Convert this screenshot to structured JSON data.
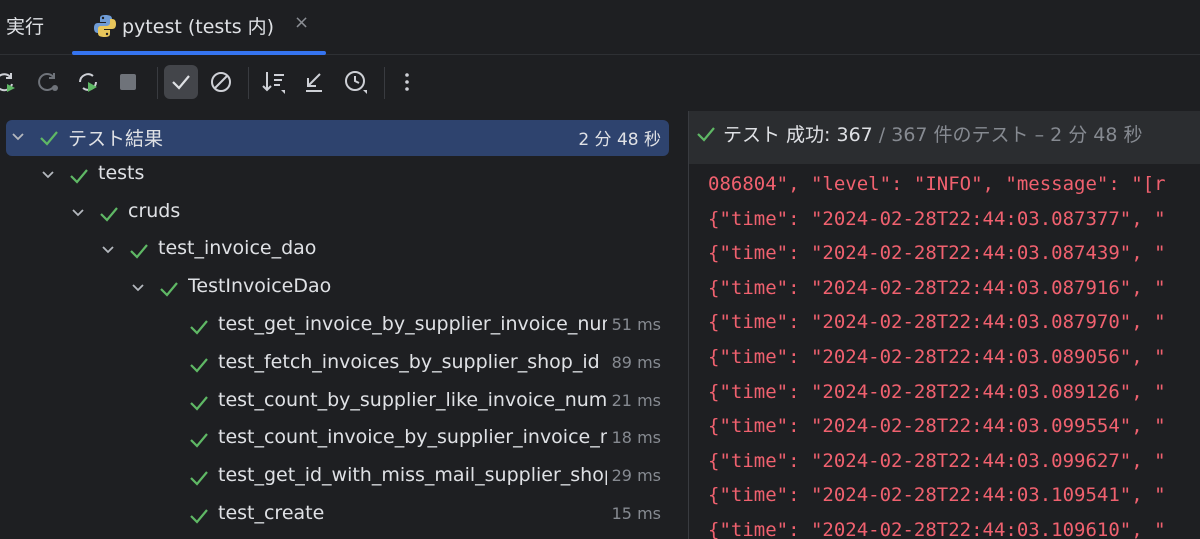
{
  "topbar": {
    "run_label": "実行",
    "tab_label": "pytest (tests 内)",
    "tab_close": "×"
  },
  "toolbar": {
    "buttons": [
      "rerun-icon",
      "rerun-failed-icon",
      "toggle-auto-test-icon",
      "stop-icon",
      "show-passed-icon",
      "show-ignored-icon",
      "sort-alpha-icon",
      "sort-import-icon",
      "sort-duration-icon",
      "more-icon"
    ]
  },
  "tree": {
    "root": {
      "label": "テスト結果",
      "time": "2 分 48 秒"
    },
    "tests": {
      "label": "tests"
    },
    "cruds": {
      "label": "cruds"
    },
    "module": {
      "label": "test_invoice_dao"
    },
    "class": {
      "label": "TestInvoiceDao"
    },
    "items": [
      {
        "label": "test_get_invoice_by_supplier_invoice_num",
        "time": "51 ms"
      },
      {
        "label": "test_fetch_invoices_by_supplier_shop_id",
        "time": "89 ms"
      },
      {
        "label": "test_count_by_supplier_like_invoice_num",
        "time": "21 ms"
      },
      {
        "label": "test_count_invoice_by_supplier_invoice_num",
        "time": "18 ms"
      },
      {
        "label": "test_get_id_with_miss_mail_supplier_shop",
        "time": "29 ms"
      },
      {
        "label": "test_create",
        "time": "15 ms"
      }
    ]
  },
  "status": {
    "label": "テスト 成功: 367",
    "detail": " / 367 件のテスト – 2 分 48 秒"
  },
  "console": {
    "lines": [
      "086804\", \"level\": \"INFO\", \"message\": \"[r",
      "{\"time\": \"2024-02-28T22:44:03.087377\", \"",
      "{\"time\": \"2024-02-28T22:44:03.087439\", \"",
      "{\"time\": \"2024-02-28T22:44:03.087916\", \"",
      "{\"time\": \"2024-02-28T22:44:03.087970\", \"",
      "{\"time\": \"2024-02-28T22:44:03.089056\", \"",
      "{\"time\": \"2024-02-28T22:44:03.089126\", \"",
      "{\"time\": \"2024-02-28T22:44:03.099554\", \"",
      "{\"time\": \"2024-02-28T22:44:03.099627\", \"",
      "{\"time\": \"2024-02-28T22:44:03.109541\", \"",
      "{\"time\": \"2024-02-28T22:44:03.109610\", \""
    ]
  },
  "colors": {
    "pass_green": "#5fb865",
    "selection": "#2e436e",
    "accent": "#3574f0",
    "console_red": "#f0616f"
  }
}
